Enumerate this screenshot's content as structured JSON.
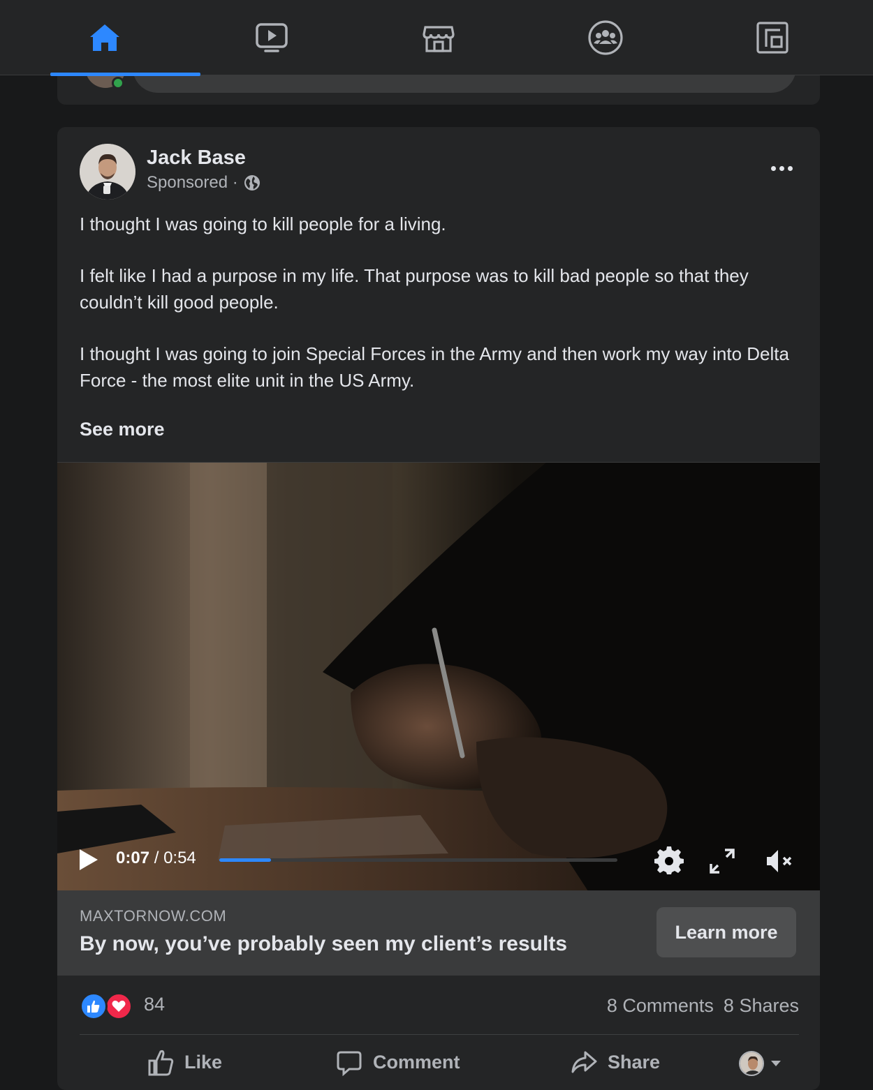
{
  "nav": {
    "tabs": [
      {
        "name": "home",
        "icon": "home-icon",
        "active": true
      },
      {
        "name": "watch",
        "icon": "video-icon",
        "active": false
      },
      {
        "name": "marketplace",
        "icon": "store-icon",
        "active": false
      },
      {
        "name": "groups",
        "icon": "groups-icon",
        "active": false
      },
      {
        "name": "gaming",
        "icon": "gaming-icon",
        "active": false
      }
    ],
    "accent_color": "#2d88ff"
  },
  "post": {
    "author": "Jack Base",
    "sponsored_label": "Sponsored ·",
    "audience_icon": "globe-icon",
    "paragraphs": [
      "I thought I was going to kill people for a living.",
      "I felt like I had a purpose in my life. That purpose was to kill bad people so that they couldn’t kill good people.",
      "I thought I was going to join Special Forces in the Army and then work my way into Delta Force - the most elite unit in the US Army."
    ],
    "see_more": "See more"
  },
  "video": {
    "current_time": "0:07",
    "separator": " / ",
    "duration": "0:54",
    "progress_fraction": 0.13
  },
  "link": {
    "domain": "MAXTORNOW.COM",
    "headline": "By now, you’ve probably seen my client’s results",
    "cta": "Learn more"
  },
  "engagement": {
    "reaction_count": "84",
    "comments": "8 Comments",
    "shares": "8 Shares"
  },
  "actions": {
    "like": "Like",
    "comment": "Comment",
    "share": "Share"
  }
}
